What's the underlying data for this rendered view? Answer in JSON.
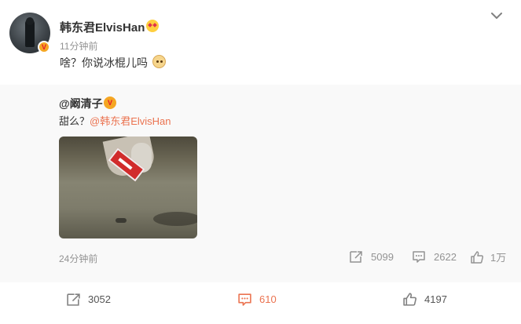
{
  "post": {
    "author": "韩东君ElvisHan",
    "time": "11分钟前",
    "text": "啥？你说冰棍儿吗",
    "author_emoji": "heart-eyes-emoji",
    "text_emoji": "dog-emoji"
  },
  "repost": {
    "author": "@阚清子",
    "text_prefix": "甜么？",
    "mention": "@韩东君ElvisHan",
    "time": "24分钟前",
    "repost_count": "5099",
    "comment_count": "2622",
    "like_count": "1万"
  },
  "actions": {
    "repost_count": "3052",
    "comment_count": "610",
    "like_count": "4197"
  },
  "colors": {
    "accent": "#eb7350",
    "muted": "#939393",
    "verified": "#f5a623"
  }
}
